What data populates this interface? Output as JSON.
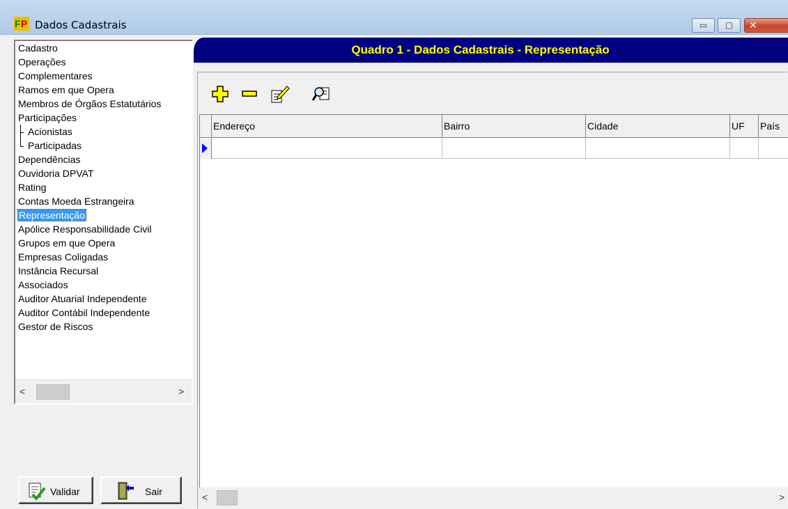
{
  "window": {
    "title": "Dados Cadastrais",
    "icon": "fp-app-icon",
    "minimize_glyph": "▭",
    "maximize_glyph": "▢",
    "close_glyph": "✕"
  },
  "tree": {
    "items": [
      {
        "label": "Cadastro"
      },
      {
        "label": "Operações"
      },
      {
        "label": "Complementares"
      },
      {
        "label": "Ramos em que Opera"
      },
      {
        "label": "Membros de Órgãos Estatutários"
      },
      {
        "label": "Participações"
      },
      {
        "label": "Acionistas"
      },
      {
        "label": "Participadas"
      },
      {
        "label": "Dependências"
      },
      {
        "label": "Ouvidoria DPVAT"
      },
      {
        "label": "Rating"
      },
      {
        "label": "Contas Moeda Estrangeira"
      },
      {
        "label": "Representação"
      },
      {
        "label": "Apólice Responsabilidade Civil"
      },
      {
        "label": "Grupos em que Opera"
      },
      {
        "label": "Empresas Coligadas"
      },
      {
        "label": "Instância Recursal"
      },
      {
        "label": "Associados"
      },
      {
        "label": "Auditor Atuarial Independente"
      },
      {
        "label": "Auditor Contábil Independente"
      },
      {
        "label": "Gestor de Riscos"
      }
    ],
    "selected": "Representação",
    "scroll_left": "<",
    "scroll_right": ">"
  },
  "buttons": {
    "validar": "Validar",
    "sair": "Sair"
  },
  "header": {
    "title": "Quadro 1 - Dados Cadastrais - Representação"
  },
  "toolbar": {
    "icons": [
      "add-icon",
      "remove-icon",
      "edit-icon",
      "search-icon"
    ]
  },
  "grid": {
    "columns": [
      "Endereço",
      "Bairro",
      "Cidade",
      "UF",
      "País"
    ],
    "rows": [
      [
        "",
        "",
        "",
        "",
        ""
      ]
    ],
    "scroll_left": "<",
    "scroll_right": ">"
  },
  "colors": {
    "header_bg": "#000080",
    "header_text": "#ffff00",
    "selection": "#3399ff",
    "row_indicator": "#0000ff"
  }
}
